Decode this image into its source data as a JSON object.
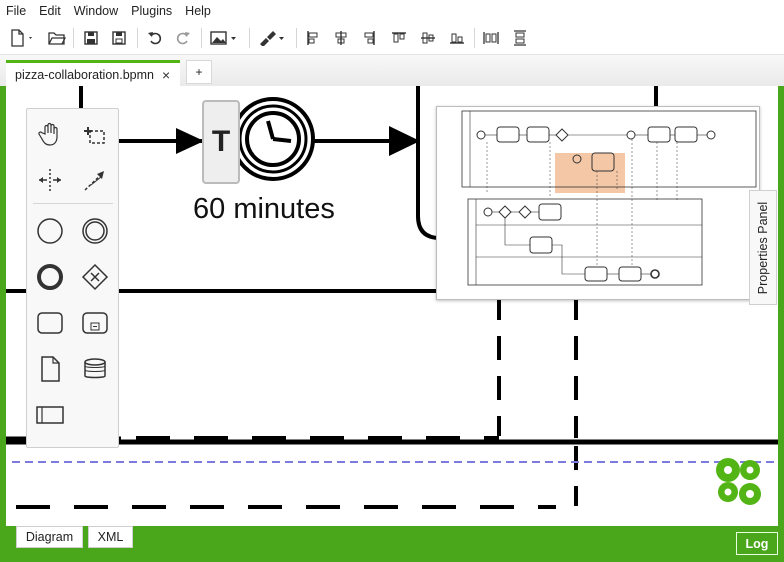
{
  "menu": [
    "File",
    "Edit",
    "Window",
    "Plugins",
    "Help"
  ],
  "toolbar": {
    "groups": [
      "file",
      "edit",
      "image",
      "format",
      "align",
      "distribute"
    ]
  },
  "tabs": {
    "active_label": "pizza-collaboration.bpmn",
    "close_glyph": "×",
    "add_label": "+"
  },
  "canvas": {
    "timer_label": "60 minutes",
    "text_tool": "T"
  },
  "properties_panel": {
    "label": "Properties Panel"
  },
  "view_tabs": {
    "diagram": "Diagram",
    "xml": "XML"
  },
  "log_label": "Log",
  "colors": {
    "accent": "#52b415",
    "frame": "#4aa61b",
    "minimap_highlight": "#f4c7a6",
    "lane_divider": "#7b7be0"
  },
  "palette_tools": [
    "hand-tool-icon",
    "lasso-tool-icon",
    "space-tool-icon",
    "connect-tool-icon",
    "start-event-icon",
    "intermediate-event-icon",
    "end-event-icon",
    "gateway-icon",
    "task-icon",
    "subprocess-icon",
    "data-object-icon",
    "data-store-icon",
    "pool-icon"
  ]
}
